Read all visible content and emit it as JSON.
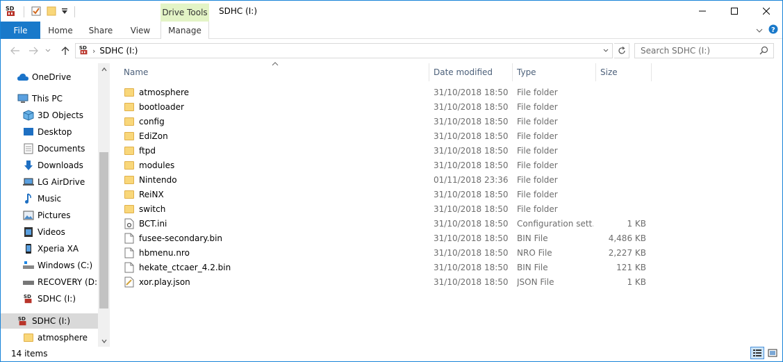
{
  "titlebar": {
    "context_tab": "Drive Tools",
    "title": "SDHC (I:)",
    "minimize": "—",
    "maximize": "☐",
    "close": "✕"
  },
  "ribbon": {
    "tabs": [
      {
        "label": "File"
      },
      {
        "label": "Home"
      },
      {
        "label": "Share"
      },
      {
        "label": "View"
      },
      {
        "label": "Manage"
      }
    ]
  },
  "address": {
    "crumb": "SDHC (I:)",
    "search_placeholder": "Search SDHC (I:)"
  },
  "nav": {
    "items": [
      {
        "label": "OneDrive",
        "icon": "cloud-icon"
      },
      {
        "label": "This PC",
        "icon": "computer-icon"
      },
      {
        "label": "3D Objects",
        "icon": "cube-icon"
      },
      {
        "label": "Desktop",
        "icon": "desktop-icon"
      },
      {
        "label": "Documents",
        "icon": "document-icon"
      },
      {
        "label": "Downloads",
        "icon": "download-icon"
      },
      {
        "label": "LG AirDrive",
        "icon": "laptop-icon"
      },
      {
        "label": "Music",
        "icon": "music-icon"
      },
      {
        "label": "Pictures",
        "icon": "picture-icon"
      },
      {
        "label": "Videos",
        "icon": "video-icon"
      },
      {
        "label": "Xperia XA",
        "icon": "phone-icon"
      },
      {
        "label": "Windows (C:)",
        "icon": "drive-icon"
      },
      {
        "label": "RECOVERY (D:)",
        "icon": "drive-icon"
      },
      {
        "label": "SDHC (I:)",
        "icon": "sd-card-icon"
      },
      {
        "label": "SDHC (I:)",
        "icon": "sd-card-icon"
      },
      {
        "label": "atmosphere",
        "icon": "folder-icon"
      }
    ]
  },
  "columns": {
    "name": "Name",
    "date": "Date modified",
    "type": "Type",
    "size": "Size"
  },
  "files": [
    {
      "name": "atmosphere",
      "date": "31/10/2018 18:50",
      "type": "File folder",
      "size": "",
      "icon": "folder-icon"
    },
    {
      "name": "bootloader",
      "date": "31/10/2018 18:50",
      "type": "File folder",
      "size": "",
      "icon": "folder-icon"
    },
    {
      "name": "config",
      "date": "31/10/2018 18:50",
      "type": "File folder",
      "size": "",
      "icon": "folder-icon"
    },
    {
      "name": "EdiZon",
      "date": "31/10/2018 18:50",
      "type": "File folder",
      "size": "",
      "icon": "folder-icon"
    },
    {
      "name": "ftpd",
      "date": "31/10/2018 18:50",
      "type": "File folder",
      "size": "",
      "icon": "folder-icon"
    },
    {
      "name": "modules",
      "date": "31/10/2018 18:50",
      "type": "File folder",
      "size": "",
      "icon": "folder-icon"
    },
    {
      "name": "Nintendo",
      "date": "01/11/2018 23:36",
      "type": "File folder",
      "size": "",
      "icon": "folder-icon"
    },
    {
      "name": "ReiNX",
      "date": "31/10/2018 18:50",
      "type": "File folder",
      "size": "",
      "icon": "folder-icon"
    },
    {
      "name": "switch",
      "date": "31/10/2018 18:50",
      "type": "File folder",
      "size": "",
      "icon": "folder-icon"
    },
    {
      "name": "BCT.ini",
      "date": "31/10/2018 18:50",
      "type": "Configuration sett...",
      "size": "1 KB",
      "icon": "settings-file-icon"
    },
    {
      "name": "fusee-secondary.bin",
      "date": "31/10/2018 18:50",
      "type": "BIN File",
      "size": "4,486 KB",
      "icon": "file-icon"
    },
    {
      "name": "hbmenu.nro",
      "date": "31/10/2018 18:50",
      "type": "NRO File",
      "size": "2,227 KB",
      "icon": "file-icon"
    },
    {
      "name": "hekate_ctcaer_4.2.bin",
      "date": "31/10/2018 18:50",
      "type": "BIN File",
      "size": "121 KB",
      "icon": "file-icon"
    },
    {
      "name": "xor.play.json",
      "date": "31/10/2018 18:50",
      "type": "JSON File",
      "size": "1 KB",
      "icon": "json-file-icon"
    }
  ],
  "status": {
    "count": "14 items"
  },
  "colors": {
    "accent": "#1979ca",
    "context_tab": "#e3f4c6",
    "folder": "#f9d77a"
  }
}
